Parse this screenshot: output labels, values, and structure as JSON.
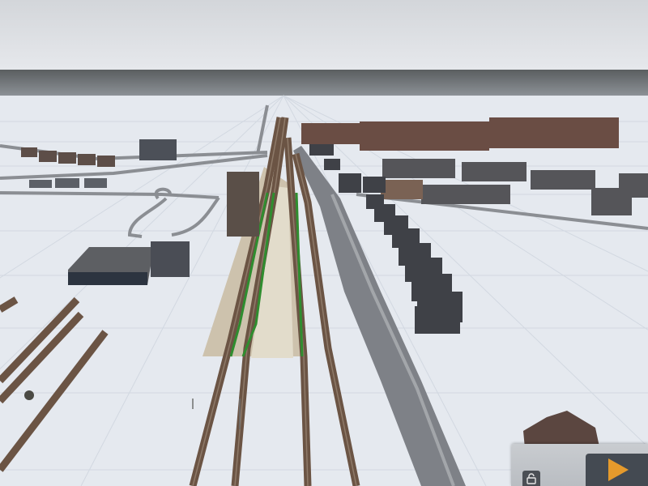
{
  "app": {
    "title": ""
  },
  "scene": {
    "description_colors": {
      "sky_top": "#d6d9dd",
      "sky_bottom": "#e3e5e9",
      "horizon_band": "#5f6366",
      "ground": "#e4e8ef",
      "grid_line": "#cfd5de",
      "track": "#6b5444",
      "road": "#7d8086",
      "platform": "#cdc2ad",
      "green_line": "#2e8c2e",
      "roof_dark": "#3d3f44",
      "house_wall": "#6a4d44"
    }
  },
  "controls": {
    "lock": {
      "icon": "unlock-icon"
    },
    "play": {
      "icon": "play-triangle-icon",
      "accent": "#e59a2c"
    }
  }
}
